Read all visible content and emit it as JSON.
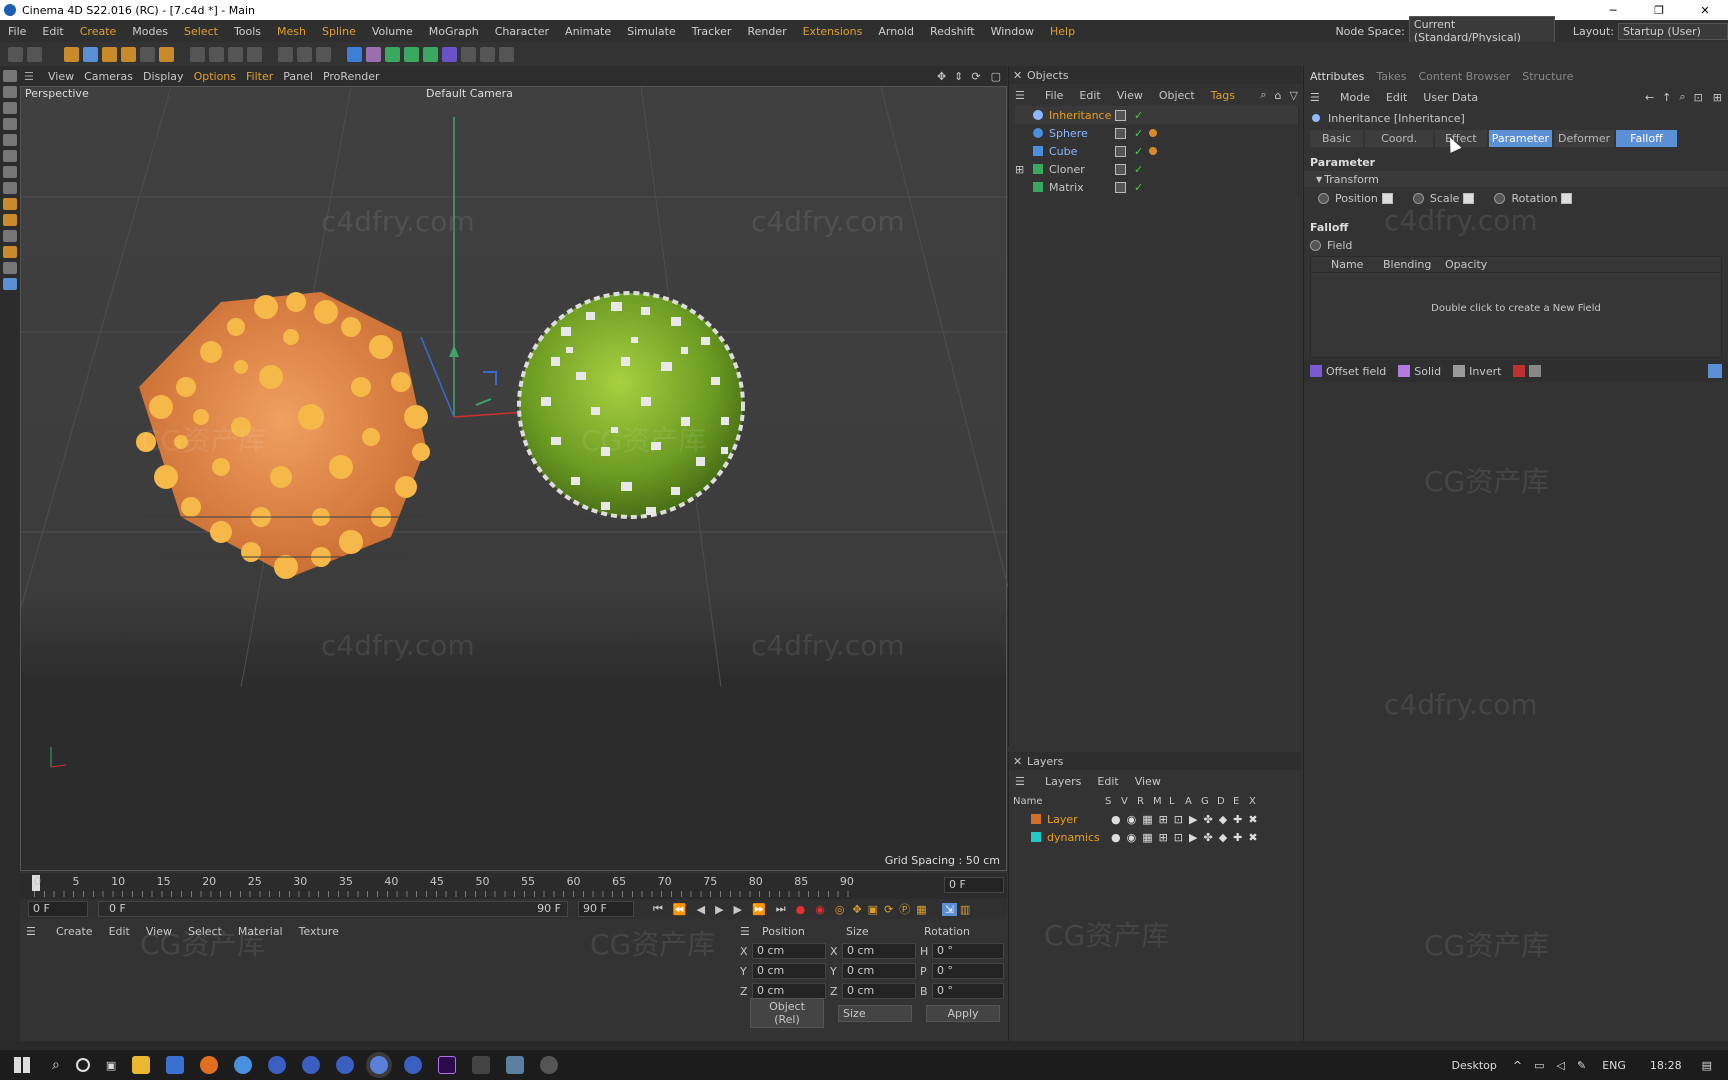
{
  "titlebar": {
    "title": "Cinema 4D S22.016 (RC) - [7.c4d *] - Main"
  },
  "menubar": {
    "items": [
      "File",
      "Edit",
      "Create",
      "Modes",
      "Select",
      "Tools",
      "Mesh",
      "Spline",
      "Volume",
      "MoGraph",
      "Character",
      "Animate",
      "Simulate",
      "Tracker",
      "Render",
      "Extensions",
      "Arnold",
      "Redshift",
      "Window",
      "Help"
    ],
    "node_space_label": "Node Space:",
    "node_space_value": "Current (Standard/Physical)",
    "layout_label": "Layout:",
    "layout_value": "Startup (User)"
  },
  "viewport": {
    "menu": [
      "View",
      "Cameras",
      "Display",
      "Options",
      "Filter",
      "Panel",
      "ProRender"
    ],
    "view_name": "Perspective",
    "camera": "Default Camera",
    "grid_spacing": "Grid Spacing : 50 cm",
    "watermark": "c4dfry.com",
    "watermark_cn": "CG资产库"
  },
  "objects": {
    "title": "Objects",
    "menu": [
      "File",
      "Edit",
      "View",
      "Object",
      "Tags"
    ],
    "items": [
      {
        "name": "Inheritance",
        "color": "#e8a020"
      },
      {
        "name": "Sphere",
        "color": "#8fb8ff"
      },
      {
        "name": "Cube",
        "color": "#8fb8ff"
      },
      {
        "name": "Cloner",
        "color": "#c8c8c8"
      },
      {
        "name": "Matrix",
        "color": "#c8c8c8"
      }
    ]
  },
  "layers": {
    "title": "Layers",
    "menu": [
      "Layers",
      "Edit",
      "View"
    ],
    "columns": [
      "Name",
      "S",
      "V",
      "R",
      "M",
      "L",
      "A",
      "G",
      "D",
      "E",
      "X"
    ],
    "items": [
      {
        "name": "Layer",
        "color": "#d0702a",
        "text_color": "#e8a020"
      },
      {
        "name": "dynamics",
        "color": "#20c8c8",
        "text_color": "#e8a020"
      }
    ]
  },
  "attributes": {
    "tabs": [
      "Attributes",
      "Takes",
      "Content Browser",
      "Structure"
    ],
    "menu": [
      "Mode",
      "Edit",
      "User Data"
    ],
    "object_name": "Inheritance [Inheritance]",
    "subtabs": [
      "Basic",
      "Coord.",
      "Effect",
      "Parameter",
      "Deformer",
      "Falloff"
    ],
    "parameter_title": "Parameter",
    "transform_label": "Transform",
    "position_label": "Position",
    "scale_label": "Scale",
    "rotation_label": "Rotation",
    "falloff_title": "Falloff",
    "field_label": "Field",
    "field_cols": [
      "Name",
      "Blending",
      "Opacity"
    ],
    "field_hint": "Double click to create a New Field",
    "field_buttons": [
      "Offset field",
      "Solid",
      "Invert"
    ]
  },
  "timeline": {
    "ticks": [
      "0",
      "5",
      "10",
      "15",
      "20",
      "25",
      "30",
      "35",
      "40",
      "45",
      "50",
      "55",
      "60",
      "65",
      "70",
      "75",
      "80",
      "85",
      "90"
    ],
    "current": "0 F",
    "start": "0 F",
    "range_start": "0 F",
    "range_end": "90 F",
    "end": "90 F"
  },
  "material": {
    "menu": [
      "Create",
      "Edit",
      "View",
      "Select",
      "Material",
      "Texture"
    ]
  },
  "coords": {
    "headers": [
      "Position",
      "Size",
      "Rotation"
    ],
    "rows": [
      {
        "a": "X",
        "pv": "0 cm",
        "b": "X",
        "sv": "0 cm",
        "c": "H",
        "rv": "0 °"
      },
      {
        "a": "Y",
        "pv": "0 cm",
        "b": "Y",
        "sv": "0 cm",
        "c": "P",
        "rv": "0 °"
      },
      {
        "a": "Z",
        "pv": "0 cm",
        "b": "Z",
        "sv": "0 cm",
        "c": "B",
        "rv": "0 °"
      }
    ],
    "mode": "Object (Rel)",
    "size_mode": "Size",
    "apply": "Apply"
  },
  "taskbar": {
    "desktop": "Desktop",
    "lang": "ENG",
    "time": "18:28"
  }
}
